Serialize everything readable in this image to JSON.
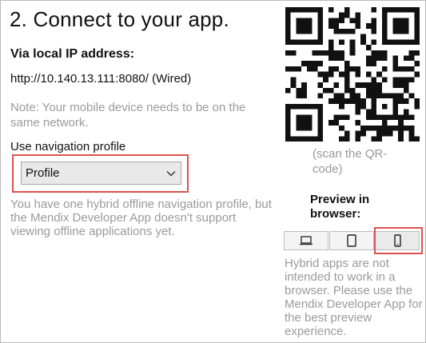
{
  "section": {
    "title": "2. Connect to your app.",
    "subhead": "Via local IP address:",
    "url": "http://10.140.13.111:8080/ (Wired)",
    "note": "Note: Your mobile device needs to be on the same network."
  },
  "navigation": {
    "label": "Use navigation profile",
    "selected": "Profile",
    "hint": "You have one hybrid offline navigation profile, but the Mendix Developer App doesn't support viewing offline applications yet."
  },
  "qr": {
    "caption": "(scan the QR-code)"
  },
  "preview": {
    "title": "Preview in browser:",
    "devices": [
      {
        "icon": "laptop-icon"
      },
      {
        "icon": "tablet-icon"
      },
      {
        "icon": "phone-icon"
      }
    ],
    "note": "Hybrid apps are not intended to work in a browser. Please use the Mendix Developer App for the best preview experience."
  },
  "colors": {
    "highlight": "#d9534f",
    "muted_text": "#9a9a9a"
  }
}
